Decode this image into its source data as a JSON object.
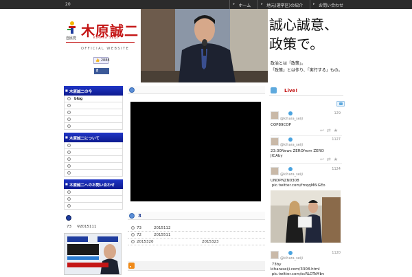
{
  "topbar": {
    "number": "20",
    "nav": [
      "ホーム",
      "地元(選挙区)の紹介",
      "お問い合わせ"
    ]
  },
  "header": {
    "logo_name": "木原誠二",
    "party": "自民党",
    "kana": "KIHARA SEIJI",
    "official": "OFFICIAL WEBSITE",
    "like_count": "2888",
    "share_label": "f",
    "slogan_line1": "誠心誠意、",
    "slogan_line2": "政策で。",
    "slogan_sub1": "政治とは「政策」。",
    "slogan_sub2": "「政策」とは作り、「実行する」もの。"
  },
  "sidebar": {
    "sections": [
      {
        "title": "木原誠二の今",
        "items": [
          "blog",
          "",
          "",
          "",
          ""
        ]
      },
      {
        "title": "木原誠二について",
        "items": [
          "",
          "",
          "",
          "",
          ""
        ]
      },
      {
        "title": "木原誠二へのお問い合わせ",
        "items": [
          "",
          "",
          ""
        ]
      }
    ],
    "count": "73",
    "date": "2015111"
  },
  "center": {
    "section1_title": "",
    "section2_title": "3",
    "rows": [
      {
        "a": "73",
        "b": "",
        "c": "2015112"
      },
      {
        "a": "72",
        "b": "",
        "c": "2015511"
      },
      {
        "a": "2015320",
        "b": "",
        "c": "2015323"
      }
    ]
  },
  "twitter": {
    "title": "Live!",
    "handle": "@kihara_seiji",
    "tweets": [
      {
        "count": "129",
        "text": "COP89COP"
      },
      {
        "count": "1127",
        "text": "23:30News ZEROfrom ZERO\nJICAby"
      },
      {
        "count": "1124",
        "text": "UNDPNZN0308\n pic.twitter.com/fmqqM6iGEo"
      },
      {
        "count": "1120",
        "text": " 73by\nkiharaseiji.com/3308.html\n pic.twitter.com/scRLOTsMbv"
      }
    ]
  },
  "colors": {
    "brand_red": "#c41515",
    "nav_blue": "#0d1a8f"
  }
}
